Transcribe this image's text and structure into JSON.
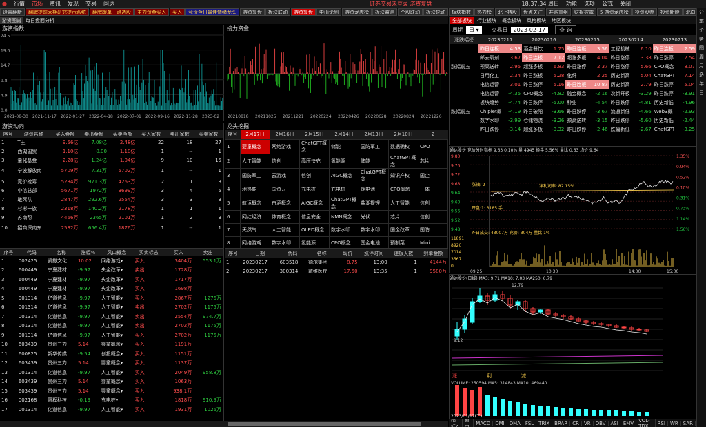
{
  "titlebar": {
    "menus": [
      "行情",
      "市场",
      "资讯",
      "发现",
      "交易",
      "问达"
    ],
    "notice": "证券交易未登录  游资复盘",
    "clock": "18:37:34 周日",
    "right": [
      "功能",
      "选项",
      "公式",
      "关闭"
    ]
  },
  "tabs": [
    {
      "l": "设置翻新",
      "s": ""
    },
    {
      "l": "翻牌提前大期研究提示系统",
      "s": "red"
    },
    {
      "l": "翻牌跟单一键选股",
      "s": "red"
    },
    {
      "l": "主力资金买入",
      "s": "red"
    },
    {
      "l": "买入",
      "s": "red"
    },
    {
      "l": "竞价今日最佳情绪龙头",
      "s": "blue"
    },
    {
      "l": "游资复盘",
      "s": ""
    },
    {
      "l": "板块联动",
      "s": ""
    },
    {
      "l": "游资复盘",
      "s": "act"
    },
    {
      "l": "中山论剑",
      "s": ""
    },
    {
      "l": "游资龙虎榜",
      "s": ""
    },
    {
      "l": "板块监测",
      "s": ""
    },
    {
      "l": "个股联动",
      "s": ""
    },
    {
      "l": "板块轮动",
      "s": ""
    },
    {
      "l": "板块指数",
      "s": ""
    },
    {
      "l": "热力榜",
      "s": ""
    },
    {
      "l": "北上持股",
      "s": ""
    },
    {
      "l": "盘点关注",
      "s": ""
    },
    {
      "l": "并购重组",
      "s": ""
    },
    {
      "l": "财报披露",
      "s": ""
    },
    {
      "l": "5 游资龙虎榜",
      "s": ""
    },
    {
      "l": "投资股票",
      "s": ""
    },
    {
      "l": "投资新股",
      "s": ""
    },
    {
      "l": "北向资金",
      "s": ""
    },
    {
      "l": "股性",
      "s": ""
    },
    {
      "l": "关闭",
      "s": ""
    }
  ],
  "subbar": {
    "items": [
      "游资图谱",
      "每日盘面分析"
    ]
  },
  "left_chart": {
    "title": "游资指数",
    "ticks": [
      "24.5",
      "19.6",
      "14.7",
      "9.8",
      "4.9",
      "0.0"
    ],
    "dates": [
      "2021-08-30",
      "2021-11-17",
      "2022-01-27",
      "2022-04-18",
      "2022-07-01",
      "2022-09-16",
      "2022-11-28",
      "2023-02"
    ]
  },
  "mid_chart": {
    "title": "接力资金",
    "dates": [
      "20210818",
      "20211025",
      "20211221",
      "20220224",
      "20220426",
      "20220628",
      "20220824",
      "20221226"
    ]
  },
  "flow": {
    "title": "游资动向",
    "headers": [
      "序号",
      "游资名称",
      "买入金额",
      "卖出金额",
      "买卖净额",
      "买入家数",
      "卖出家数",
      "买卖家数"
    ],
    "rows": [
      [
        "1",
        "T王",
        "9.56亿",
        "7.08亿",
        "2.48亿",
        "22",
        "18",
        "27"
      ],
      [
        "2",
        "西湖国贸",
        "1.10亿",
        "0.00",
        "1.10亿",
        "1",
        "--",
        "1"
      ],
      [
        "3",
        "量化基金",
        "2.28亿",
        "1.24亿",
        "1.04亿",
        "9",
        "10",
        "15"
      ],
      [
        "4",
        "宁波解放南",
        "5709万",
        "7.31万",
        "5702万",
        "1",
        "--",
        "1"
      ],
      [
        "5",
        "竞价抢筹",
        "5234万",
        "971.3万",
        "4263万",
        "2",
        "1",
        "3"
      ],
      [
        "6",
        "中信总部",
        "5671万",
        "1972万",
        "3699万",
        "3",
        "4",
        "5"
      ],
      [
        "7",
        "敢死队",
        "2847万",
        "292.6万",
        "2554万",
        "3",
        "3",
        "3"
      ],
      [
        "8",
        "杉彬一族",
        "2318万",
        "140.2万",
        "2178万",
        "1",
        "1",
        "1"
      ],
      [
        "9",
        "苏南帮",
        "4466万",
        "2365万",
        "2101万",
        "1",
        "2",
        "3"
      ],
      [
        "10",
        "招商深南东",
        "2532万",
        "656.4万",
        "1876万",
        "1",
        "--",
        "1"
      ]
    ]
  },
  "stocks": {
    "headers": [
      "序号",
      "代码",
      "名称",
      "涨幅%",
      "风口概念",
      "买卖标志",
      "买入",
      "卖出"
    ],
    "rows": [
      [
        "1",
        "002425",
        "凯撒文化",
        "10.02",
        "网络游戏",
        "买入",
        "3404万",
        "553.1万"
      ],
      [
        "2",
        "600449",
        "宁夏建材",
        "-9.97",
        "央企改革",
        "卖出",
        "1728万",
        ""
      ],
      [
        "3",
        "600449",
        "宁夏建材",
        "-9.97",
        "央企改革",
        "买入",
        "1717万",
        ""
      ],
      [
        "4",
        "600449",
        "宁夏建材",
        "-9.97",
        "央企改革",
        "买入",
        "1698万",
        ""
      ],
      [
        "5",
        "001314",
        "亿道信息",
        "-9.97",
        "人工智能",
        "买入",
        "2867万",
        "1276万"
      ],
      [
        "6",
        "001314",
        "亿道信息",
        "-9.97",
        "人工智能",
        "卖出",
        "2702万",
        "1175万"
      ],
      [
        "7",
        "001314",
        "亿道信息",
        "-9.97",
        "人工智能",
        "卖出",
        "2554万",
        "974.7万"
      ],
      [
        "8",
        "001314",
        "亿道信息",
        "-9.97",
        "人工智能",
        "卖出",
        "2702万",
        "1175万"
      ],
      [
        "9",
        "001314",
        "亿道信息",
        "-9.97",
        "人工智能",
        "买入",
        "2702万",
        "1175万"
      ],
      [
        "10",
        "603439",
        "贵州三力",
        "5.14",
        "婴童概念",
        "买入",
        "1191万",
        ""
      ],
      [
        "11",
        "600825",
        "新华传媒",
        "-9.54",
        "创投概念",
        "买入",
        "1151万",
        ""
      ],
      [
        "12",
        "603439",
        "贵州三力",
        "5.14",
        "婴童概念",
        "买入",
        "1137万",
        ""
      ],
      [
        "13",
        "001314",
        "亿道信息",
        "-9.97",
        "人工智能",
        "买入",
        "2049万",
        "958.8万"
      ],
      [
        "14",
        "603439",
        "贵州三力",
        "5.14",
        "婴童概念",
        "买入",
        "1063万",
        ""
      ],
      [
        "15",
        "603439",
        "贵州三力",
        "5.14",
        "婴童概念",
        "买入",
        "938.1万",
        ""
      ],
      [
        "16",
        "002168",
        "惠程科技",
        "-0.19",
        "充电桩",
        "买入",
        "1818万",
        "910.9万"
      ],
      [
        "17",
        "001314",
        "亿道信息",
        "-9.97",
        "人工智能",
        "买入",
        "1931万",
        "1026万"
      ]
    ]
  },
  "dragon": {
    "title": "龙头挖掘",
    "headers": [
      "序号",
      "2月17日",
      "2月16日",
      "2月15日",
      "2月14日",
      "2月13日",
      "2月10日",
      "2"
    ],
    "rows": [
      [
        "1",
        "婴童概念",
        "网络游戏",
        "ChatGPT概念",
        "储能",
        "国防军工",
        "数据确权",
        "CPO"
      ],
      [
        "2",
        "人工智能",
        "信创",
        "高压快充",
        "氢能源",
        "储能",
        "ChatGPT概念",
        "芯片"
      ],
      [
        "3",
        "国防军工",
        "云游戏",
        "信创",
        "AIGC概念",
        "ChatGPT概念",
        "知识产权",
        "国企"
      ],
      [
        "4",
        "地热能",
        "国资云",
        "充电桩",
        "充电桩",
        "锂电池",
        "CPO概念",
        "一体"
      ],
      [
        "5",
        "航运概念",
        "白酒概念",
        "AIGC概念",
        "ChatGPT概念",
        "盐湖提锂",
        "人工智能",
        "信创"
      ],
      [
        "6",
        "网红经济",
        "体育概念",
        "信息安全",
        "NMN概念",
        "光伏",
        "芯片",
        "信创"
      ],
      [
        "7",
        "天然气",
        "人工智能",
        "OLED概念",
        "数字水印",
        "数字水印",
        "国企改革",
        "国防"
      ],
      [
        "8",
        "网络游戏",
        "数字水印",
        "氢能源",
        "CPO概念",
        "国企电池",
        "预制菜",
        "Mini"
      ]
    ]
  },
  "limit": {
    "headers": [
      "序号",
      "日期",
      "代码",
      "名称",
      "现价",
      "涨停时间",
      "连板天数",
      "封单金额"
    ],
    "rows": [
      [
        "1",
        "20230217",
        "603518",
        "德尔集团",
        "8.75",
        "13:00",
        "1",
        "4144万"
      ],
      [
        "2",
        "20230217",
        "300314",
        "戴维医疗",
        "17.50",
        "13:35",
        "1",
        "9580万"
      ]
    ]
  },
  "right_panel": {
    "tabs": [
      "全部板块",
      "行业板块",
      "概念板块",
      "风格板块",
      "地区板块"
    ],
    "period_label": "周期",
    "period_value": "日",
    "date_label": "交易日",
    "date_value": "2023-02-17",
    "query": "查 询",
    "board_label": "涨跌幅榜",
    "dates": [
      "20230217",
      "20230216",
      "20230215",
      "20230214",
      "20230213"
    ],
    "up_label": "涨幅前五",
    "down_label": "跌幅前五",
    "up": [
      [
        [
          "昨日连板",
          "4.53"
        ],
        [
          "酒店餐饮",
          "1.75"
        ],
        [
          "昨日连板",
          "3.56"
        ],
        [
          "工程机械",
          "6.10"
        ],
        [
          "昨日连板",
          "2.59"
        ]
      ],
      [
        [
          "邮去氧剂",
          "3.67"
        ],
        [
          "昨日连板",
          "7.12"
        ],
        [
          "超涨多板",
          "4.04"
        ],
        [
          "昨日涨停",
          "3.38"
        ],
        [
          "昨日涨停",
          "2.54"
        ]
      ],
      [
        [
          "预高送转",
          "2.95"
        ],
        [
          "超涨多板",
          "6.83"
        ],
        [
          "昨日涨停",
          "2.37"
        ],
        [
          "昨日涨停",
          "5.66"
        ],
        [
          "CPO概念",
          "8.07"
        ]
      ],
      [
        [
          "日用化工",
          "2.34"
        ],
        [
          "昨日涨板",
          "5.28"
        ],
        [
          "化纤",
          "2.25"
        ],
        [
          "历史新高",
          "5.04"
        ],
        [
          "ChatGPT",
          "7.14"
        ]
      ],
      [
        [
          "电信运营",
          "3.01"
        ],
        [
          "昨日涨停",
          "5.16"
        ],
        [
          "昨日连板",
          "10.87"
        ],
        [
          "历史新高",
          "2.79"
        ],
        [
          "昨日涨停",
          "5.04"
        ]
      ]
    ],
    "down": [
      [
        [
          "电信运营",
          "-4.35"
        ],
        [
          "CPO概念",
          "-4.82"
        ],
        [
          "融金概念",
          "-2.16"
        ],
        [
          "次新开板",
          "-3.29"
        ],
        [
          "昨日跌停",
          "-3.91"
        ]
      ],
      [
        [
          "板块趋势",
          "-4.74"
        ],
        [
          "昨日跌停",
          "-5.00"
        ],
        [
          "种业",
          "-4.54"
        ],
        [
          "昨日跌停",
          "-4.81"
        ],
        [
          "历史新低",
          "-4.96"
        ]
      ],
      [
        [
          "Chiplet概",
          "-4.19"
        ],
        [
          "昨日破阳",
          "-3.66"
        ],
        [
          "昨日跌停",
          "-3.67"
        ],
        [
          "流通新低",
          "-4.66"
        ],
        [
          "Web3概",
          "-2.93"
        ]
      ],
      [
        [
          "数字水印",
          "-3.99"
        ],
        [
          "仓储物流",
          "-3.26"
        ],
        [
          "预高送转",
          "-3.15"
        ],
        [
          "昨日跌停",
          "-5.60"
        ],
        [
          "历史新低",
          "-2.44"
        ]
      ],
      [
        [
          "昨日跌停",
          "-3.14"
        ],
        [
          "超涨多板",
          "-3.32"
        ],
        [
          "昨日跌停",
          "-2.46"
        ],
        [
          "跌幅新低",
          "-2.67"
        ],
        [
          "ChatGPT",
          "-3.25"
        ]
      ]
    ]
  },
  "intraday": {
    "header": "通达股份  竞价分时指标  9.63  0.10%  量 4945  换手 5.56%  量比 0.63  均价 9.64",
    "pl": [
      "9.80",
      "9.76",
      "9.72",
      "9.68",
      "9.64",
      "9.60",
      "9.56",
      "9.52",
      "9.48"
    ],
    "pr": [
      "1.35%",
      "0.94%",
      "0.52%",
      "0.10%",
      "0.31%",
      "0.73%",
      "1.14%",
      "1.56%"
    ],
    "label1": "开盘:1: 3185 手",
    "label2": "昨日成交: 43007万 竞价: 304万 量比 1%",
    "label3": "涨轴: 2",
    "vol": [
      "11891",
      "8920",
      "7014",
      "3567",
      "0"
    ],
    "times": [
      "09:25",
      "10:30",
      "14:00",
      "15:00"
    ],
    "avgline": "净利润率: 82.15%"
  },
  "kline": {
    "header": "通达股份(日线)  MA3: 9.71  MA10: 7.03  MA250: 6.79",
    "hi": "12.79",
    "lo": "9.12",
    "vol_header": "VOLUME: 250594  MA5: 314843  MA10: 469440",
    "date": "2023/01/17(二)",
    "marks": [
      "涨",
      "利",
      "减"
    ]
  },
  "rightbar": [
    "分",
    "笔",
    "价",
    "势",
    "图",
    "周",
    "月",
    "多",
    "年",
    "日"
  ],
  "bottom_tabs": [
    "指标A",
    "窗口",
    "MACD",
    "DMI",
    "DMA",
    "FSL",
    "TRIX",
    "BRAR",
    "CR",
    "VR",
    "OBV",
    "ASI",
    "EMV",
    "VOL-TDX",
    "RSI",
    "WR",
    "SAR"
  ],
  "colors": {
    "up": "#ff4d4d",
    "down": "#2ecc40",
    "accent": "#ffd24d"
  }
}
